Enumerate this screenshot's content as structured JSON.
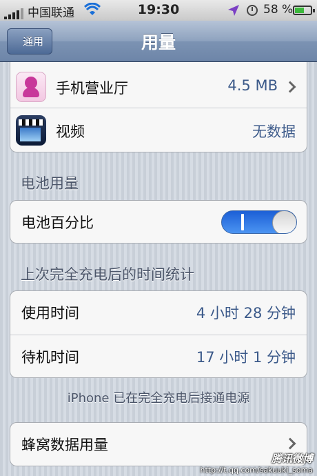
{
  "status_bar": {
    "carrier": "中国联通",
    "time": "19:30",
    "battery_percent_text": "58 %",
    "battery_level": 0.58
  },
  "nav": {
    "back_label": "通用",
    "title": "用量"
  },
  "app_usage": {
    "items": [
      {
        "label": "手机营业厅",
        "value": "4.5 MB",
        "icon": "mobile-hall-icon",
        "has_chevron": true
      },
      {
        "label": "视频",
        "value": "无数据",
        "icon": "video-icon",
        "has_chevron": false
      }
    ]
  },
  "battery_usage": {
    "header": "电池用量",
    "percentage_label": "电池百分比",
    "percentage_enabled": true
  },
  "time_since_charge": {
    "header": "上次完全充电后的时间统计",
    "usage_label": "使用时间",
    "usage_value": "4 小时 28 分钟",
    "standby_label": "待机时间",
    "standby_value": "17 小时 1 分钟",
    "note": "iPhone 已在完全充电后接通电源"
  },
  "cellular": {
    "label": "蜂窝数据用量"
  },
  "watermark": {
    "title": "腾讯微博",
    "url": "http://t.qq.com/sakuuki_soma"
  },
  "colors": {
    "value_text": "#3c5a8a",
    "toggle_on": "#1c5fd6",
    "nav_bar": "#7c93b3"
  }
}
